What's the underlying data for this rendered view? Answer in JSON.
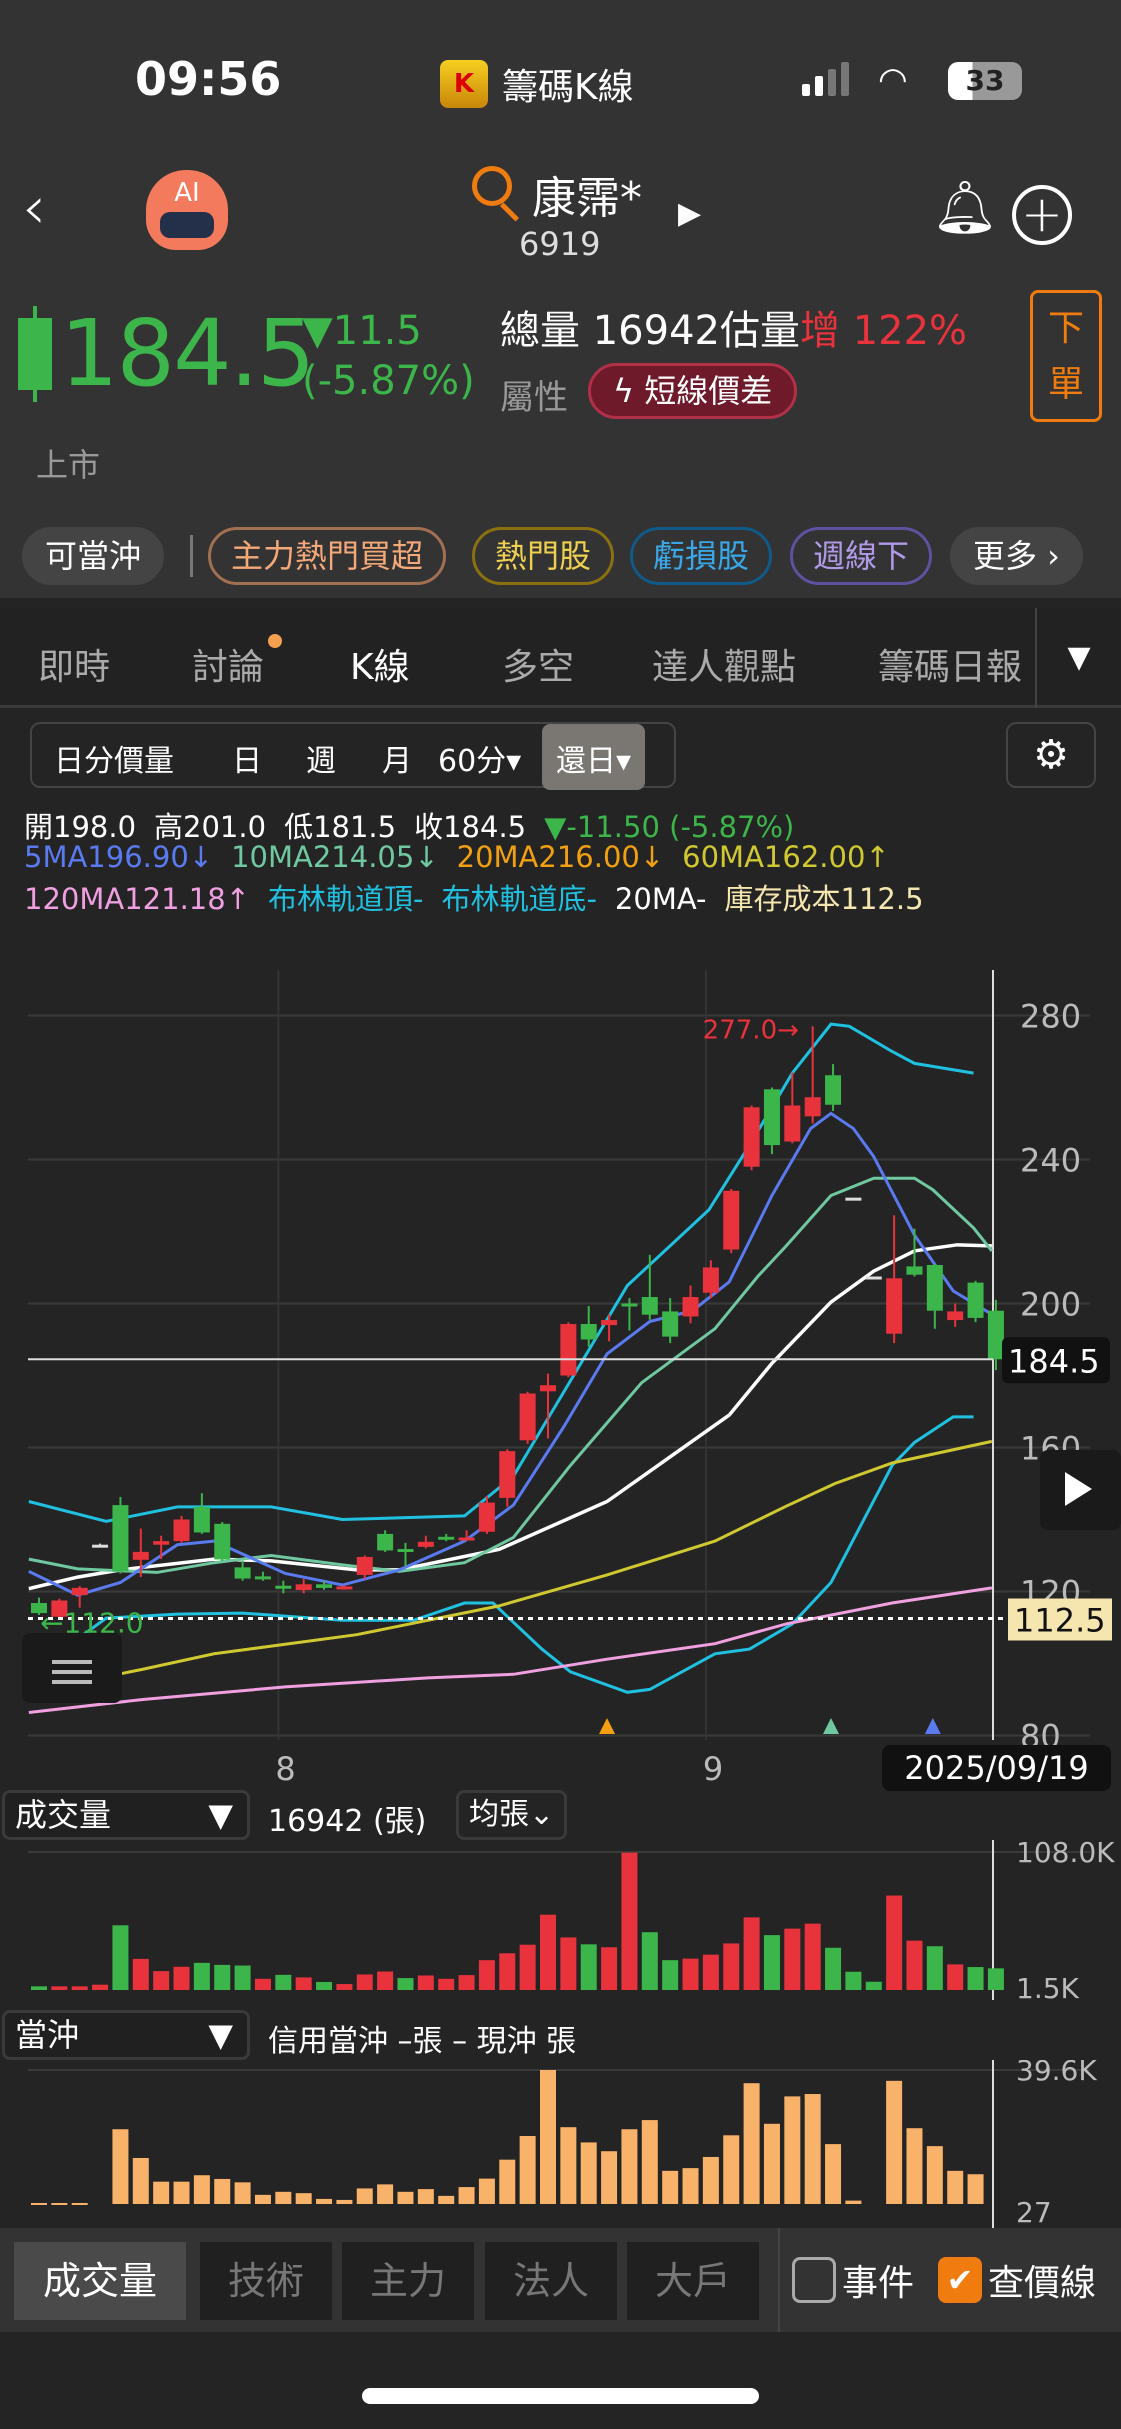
{
  "status_bar": {
    "time": "09:56",
    "app_name": "籌碼K線",
    "app_logo_letter": "K",
    "battery": "33"
  },
  "header": {
    "stock_name": "康霈*",
    "stock_code": "6919",
    "icons": [
      "back-icon",
      "ai-robot-icon",
      "search-icon",
      "next-icon",
      "bell-icon",
      "add-icon"
    ]
  },
  "quote": {
    "price": "184.5",
    "change": "▼11.5",
    "change_pct": "(-5.87%)",
    "volume_label": "總量",
    "volume": "16942",
    "est_label": "估量",
    "est_dir": "增",
    "est_pct": "122%",
    "attr_label": "屬性",
    "attr_badge": "短線價差",
    "market": "上市",
    "order_button": "下單",
    "colors": {
      "up": "#e8323c",
      "down": "#3cb54a",
      "accent": "#f07c10"
    }
  },
  "tags": [
    {
      "label": "可當沖",
      "color": "#ffffff"
    },
    {
      "label": "主力熱門買超",
      "color": "#f5a878"
    },
    {
      "label": "熱門股",
      "color": "#f0d050"
    },
    {
      "label": "虧損股",
      "color": "#3aa8e8"
    },
    {
      "label": "週線下",
      "color": "#b09ae8"
    },
    {
      "label": "更多 ›",
      "color": "#ffffff"
    }
  ],
  "tabs": [
    "即時",
    "討論",
    "K線",
    "多空",
    "達人觀點",
    "籌碼日報"
  ],
  "active_tab": "K線",
  "periods": [
    "日分價量",
    "日",
    "週",
    "月",
    "60分▾",
    "還日▾"
  ],
  "ohlc_line": {
    "open": "開198.0",
    "high": "高201.0",
    "low": "低181.5",
    "close": "收184.5",
    "change": "▼-11.50 (-5.87%)"
  },
  "ma_line1": [
    {
      "text": "5MA196.90↓",
      "color": "#5a7af0"
    },
    {
      "text": "10MA214.05↓",
      "color": "#6fc8a0"
    },
    {
      "text": "20MA216.00↓",
      "color": "#f0a010"
    },
    {
      "text": "60MA162.00↑",
      "color": "#d0c830"
    }
  ],
  "ma_line2": [
    {
      "text": "120MA121.18↑",
      "color": "#f0a0e0"
    },
    {
      "text": "布林軌道頂-",
      "color": "#20c0e0"
    },
    {
      "text": "布林軌道底-",
      "color": "#20c0e0"
    },
    {
      "text": "20MA-",
      "color": "#ffffff"
    },
    {
      "text": "庫存成本112.5",
      "color": "#f5e6b0"
    }
  ],
  "chart_data": {
    "type": "candlestick",
    "y_ticks": [
      280,
      240,
      200,
      160,
      120,
      80
    ],
    "ylim": [
      80,
      280
    ],
    "x_labels": [
      {
        "index": 12,
        "label": "8"
      },
      {
        "index": 33,
        "label": "9"
      }
    ],
    "current_price_label": "184.5",
    "cost_label": "112.5",
    "cost_value": 112.5,
    "low_marker": "←112.0",
    "high_marker": "277.0→",
    "high_index": 38,
    "selected_date": "2025/09/19",
    "candles": [
      [
        116.8,
        118.3,
        113.5,
        114
      ],
      [
        113,
        118,
        112.5,
        117.5
      ],
      [
        119,
        121.5,
        115.5,
        121
      ],
      [
        133,
        133.3,
        132.7,
        133
      ],
      [
        144,
        146.3,
        125,
        125.6
      ],
      [
        128.8,
        137.5,
        124,
        131
      ],
      [
        133,
        135.5,
        129,
        134
      ],
      [
        134,
        141,
        133.5,
        140
      ],
      [
        143.5,
        147.3,
        136,
        136.4
      ],
      [
        138.8,
        139.3,
        128.4,
        128.9
      ],
      [
        126.7,
        128.5,
        123,
        123.6
      ],
      [
        124.2,
        125.5,
        123,
        124
      ],
      [
        121.6,
        123,
        119.5,
        121.4
      ],
      [
        120.4,
        123.5,
        119.5,
        122
      ],
      [
        122,
        123,
        120.5,
        121
      ],
      [
        121.2,
        121.8,
        120.5,
        121.4
      ],
      [
        124.6,
        130,
        123.5,
        129.6
      ],
      [
        136,
        137,
        131,
        131.4
      ],
      [
        131.8,
        133.5,
        127,
        131.7
      ],
      [
        132.4,
        135.5,
        132,
        133.8
      ],
      [
        135.2,
        136,
        134,
        135
      ],
      [
        134.8,
        137,
        134.5,
        135
      ],
      [
        136.6,
        146.5,
        136,
        144.7
      ],
      [
        146,
        159.5,
        143.5,
        159
      ],
      [
        162,
        175.5,
        161,
        175
      ],
      [
        175.6,
        180.5,
        162.5,
        177.3
      ],
      [
        180,
        194.8,
        179.5,
        194.3
      ],
      [
        194.3,
        199.3,
        188,
        190
      ],
      [
        194,
        197,
        189.5,
        195.4
      ],
      [
        200,
        201.5,
        192.5,
        199.7
      ],
      [
        201.8,
        213.5,
        195.5,
        196.9
      ],
      [
        197.8,
        201.5,
        189,
        190.8
      ],
      [
        196.4,
        205,
        194.5,
        201.8
      ],
      [
        203,
        212,
        201.5,
        210
      ],
      [
        215,
        231.8,
        214,
        231.3
      ],
      [
        238,
        255,
        237,
        254.5
      ],
      [
        259.5,
        260,
        241.5,
        244
      ],
      [
        245,
        264.2,
        244.5,
        255
      ],
      [
        252,
        277,
        250,
        257.3
      ],
      [
        263.4,
        266.5,
        253.5,
        255.2
      ],
      [
        229.4,
        229.4,
        229.4,
        229.4
      ],
      [
        207.5,
        207.5,
        207.5,
        207.5
      ],
      [
        191.6,
        224.5,
        189,
        207
      ],
      [
        210.3,
        220.8,
        207.5,
        208
      ],
      [
        210.7,
        211,
        193,
        198
      ],
      [
        195.4,
        200,
        193.5,
        197.8
      ],
      [
        205.8,
        206.3,
        194.8,
        196
      ],
      [
        198,
        201,
        181.5,
        184.5
      ]
    ],
    "series": [
      {
        "name": "布林軌道頂",
        "color": "#20c0e0",
        "points": [
          [
            -0.5,
            145
          ],
          [
            3.3,
            139.5
          ],
          [
            6.8,
            143.5
          ],
          [
            11.4,
            143.5
          ],
          [
            14.9,
            140
          ],
          [
            20.9,
            141
          ],
          [
            23.3,
            152
          ],
          [
            28.9,
            205
          ],
          [
            32.9,
            226
          ],
          [
            34.9,
            244
          ],
          [
            37,
            264
          ],
          [
            38.9,
            277.6
          ],
          [
            39.8,
            277
          ],
          [
            41.9,
            270
          ],
          [
            43,
            266.7
          ],
          [
            45.9,
            264
          ]
        ]
      },
      {
        "name": "布林軌道底",
        "color": "#20c0e0",
        "points": [
          [
            -0.5,
            97
          ],
          [
            3.3,
            112.6
          ],
          [
            6.8,
            113.7
          ],
          [
            10,
            114
          ],
          [
            14.9,
            112
          ],
          [
            18.4,
            112
          ],
          [
            20.9,
            116.8
          ],
          [
            22.3,
            116.8
          ],
          [
            24.7,
            104
          ],
          [
            26.1,
            97.7
          ],
          [
            28.9,
            92
          ],
          [
            30,
            92.8
          ],
          [
            33.2,
            102.7
          ],
          [
            34.9,
            104
          ],
          [
            37,
            111
          ],
          [
            38.9,
            122.5
          ],
          [
            41.9,
            155
          ],
          [
            43,
            161.4
          ],
          [
            44.9,
            168.5
          ],
          [
            45.9,
            168.5
          ]
        ]
      },
      {
        "name": "120MA",
        "color": "#f0a0e0",
        "points": [
          [
            -0.5,
            86.4
          ],
          [
            5.1,
            90
          ],
          [
            12.1,
            93.5
          ],
          [
            19.1,
            96
          ],
          [
            23.3,
            97
          ],
          [
            27.9,
            101.2
          ],
          [
            33.2,
            105.5
          ],
          [
            36.7,
            111
          ],
          [
            41.9,
            116.8
          ],
          [
            46.8,
            121
          ]
        ]
      },
      {
        "name": "60MA",
        "color": "#d0c830",
        "points": [
          [
            -0.5,
            92
          ],
          [
            5.1,
            98.4
          ],
          [
            8.6,
            102.7
          ],
          [
            15.6,
            108
          ],
          [
            22.6,
            116
          ],
          [
            27.9,
            124.6
          ],
          [
            33.2,
            134
          ],
          [
            36.7,
            143.7
          ],
          [
            39.1,
            150
          ],
          [
            41.9,
            155.7
          ],
          [
            46.8,
            161.7
          ]
        ]
      },
      {
        "name": "20MA",
        "color": "#ffffff",
        "points": [
          [
            -0.5,
            120.8
          ],
          [
            1.9,
            124
          ],
          [
            4,
            126
          ],
          [
            8.6,
            129
          ],
          [
            11.4,
            128.5
          ],
          [
            15.6,
            126
          ],
          [
            17.7,
            126
          ],
          [
            22.6,
            131.7
          ],
          [
            27.9,
            145
          ],
          [
            31.4,
            159
          ],
          [
            33.9,
            169
          ],
          [
            36,
            183.4
          ],
          [
            38.9,
            200.4
          ],
          [
            41,
            209
          ],
          [
            43,
            214.6
          ],
          [
            45.1,
            216.3
          ],
          [
            46.8,
            216
          ]
        ]
      },
      {
        "name": "10MA",
        "color": "#6fc8a0",
        "points": [
          [
            -0.5,
            129
          ],
          [
            1.9,
            126.3
          ],
          [
            5.8,
            125.3
          ],
          [
            8.6,
            128
          ],
          [
            11.4,
            130
          ],
          [
            14.9,
            127.4
          ],
          [
            17.7,
            125.6
          ],
          [
            20.9,
            128
          ],
          [
            23.3,
            135
          ],
          [
            26.1,
            155
          ],
          [
            29.6,
            178
          ],
          [
            33.2,
            193
          ],
          [
            35.3,
            207.5
          ],
          [
            36.7,
            216
          ],
          [
            38.9,
            230
          ],
          [
            41,
            234.8
          ],
          [
            43,
            234.8
          ],
          [
            43.9,
            231.6
          ],
          [
            45.9,
            221
          ],
          [
            46.8,
            214.6
          ]
        ]
      },
      {
        "name": "5MA",
        "color": "#5a7af0",
        "points": [
          [
            -0.5,
            125.6
          ],
          [
            1.9,
            119
          ],
          [
            4,
            122.5
          ],
          [
            6.8,
            133
          ],
          [
            8.6,
            134
          ],
          [
            12.1,
            125
          ],
          [
            14.9,
            121.8
          ],
          [
            17.7,
            126
          ],
          [
            20.9,
            134
          ],
          [
            23.3,
            144
          ],
          [
            25.8,
            166
          ],
          [
            27.9,
            186
          ],
          [
            30,
            195
          ],
          [
            32.1,
            198
          ],
          [
            33.9,
            206
          ],
          [
            36,
            230
          ],
          [
            37.9,
            248.6
          ],
          [
            38.9,
            252.8
          ],
          [
            40,
            248.6
          ],
          [
            41,
            240.8
          ],
          [
            43,
            219
          ],
          [
            44.9,
            203.5
          ],
          [
            46.8,
            197
          ]
        ]
      }
    ],
    "signals": [
      {
        "index": 27.9,
        "color": "#f5a010"
      },
      {
        "index": 38.9,
        "color": "#6fc8a0"
      },
      {
        "index": 43.9,
        "color": "#5a7af0"
      }
    ]
  },
  "volume_panel": {
    "selector": "成交量",
    "value": "16942 (張)",
    "mode": "均張⌄",
    "y_max_label": "108.0K",
    "y_min_label": "1.5K",
    "ylim_k": [
      1.5,
      108
    ],
    "values_k": [
      2.8,
      2.8,
      2.8,
      4.1,
      50.6,
      24.3,
      14.7,
      18.1,
      21.2,
      19.6,
      19.1,
      8.7,
      11.8,
      9.8,
      6.2,
      4.6,
      12.1,
      14.4,
      9.3,
      11.3,
      8.7,
      11.6,
      23.3,
      28.7,
      35.4,
      58.9,
      41.1,
      35.7,
      33.4,
      107.5,
      45.2,
      23.3,
      24.5,
      27.6,
      36.4,
      56.8,
      42.9,
      48.0,
      51.9,
      33.0,
      14.2,
      6.4,
      73.9,
      38.6,
      34.2,
      20.0,
      17.9,
      16.9
    ],
    "colors": [
      "g",
      "r",
      "r",
      "r",
      "g",
      "r",
      "r",
      "r",
      "g",
      "g",
      "g",
      "r",
      "g",
      "r",
      "g",
      "r",
      "r",
      "r",
      "g",
      "r",
      "r",
      "r",
      "r",
      "r",
      "r",
      "r",
      "r",
      "g",
      "r",
      "r",
      "g",
      "g",
      "r",
      "r",
      "r",
      "r",
      "g",
      "r",
      "r",
      "g",
      "g",
      "g",
      "r",
      "r",
      "g",
      "r",
      "g",
      "g"
    ]
  },
  "daytrade_panel": {
    "selector": "當沖",
    "legend": "信用當沖 –張 – 現沖 張",
    "y_max_label": "39.6K",
    "y_min_label": "27",
    "ylim_k": [
      0,
      39.6
    ],
    "color": "#f9b26a",
    "values_k": [
      0.3,
      0.3,
      0.3,
      0,
      22.1,
      13.6,
      6.6,
      6.6,
      8.5,
      7.4,
      6.4,
      2.7,
      3.6,
      3.2,
      1.5,
      1.2,
      4.6,
      5.8,
      3.6,
      4.4,
      2.4,
      5.0,
      7.5,
      13.1,
      20.1,
      39.6,
      22.7,
      18.2,
      15.6,
      22.1,
      24.8,
      9.8,
      10.6,
      13.9,
      20.3,
      35.7,
      23.7,
      31.8,
      32.5,
      17.7,
      1.0,
      0,
      36.4,
      22.4,
      17.1,
      9.8,
      8.8,
      0
    ]
  },
  "bottom_tabs": [
    "成交量",
    "技術",
    "主力",
    "法人",
    "大戶"
  ],
  "checkboxes": [
    {
      "label": "事件",
      "checked": false
    },
    {
      "label": "查價線",
      "checked": true
    }
  ]
}
